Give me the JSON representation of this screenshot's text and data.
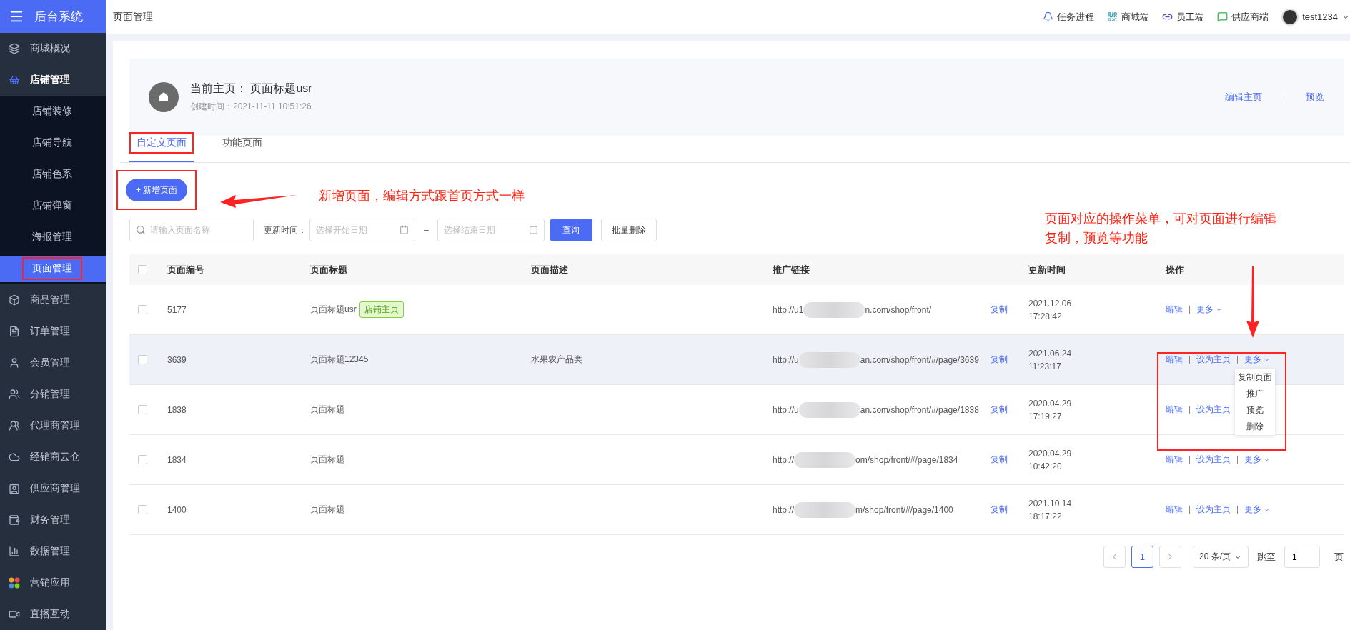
{
  "sidebar": {
    "logo": "后台系统",
    "items": [
      {
        "label": "商城概况",
        "expanded": false
      },
      {
        "label": "店铺管理",
        "expanded": true,
        "children": [
          {
            "label": "店铺装修",
            "selected": false,
            "annotated": false
          },
          {
            "label": "店铺导航",
            "selected": false,
            "annotated": false
          },
          {
            "label": "店铺色系",
            "selected": false,
            "annotated": false
          },
          {
            "label": "店铺弹窗",
            "selected": false,
            "annotated": false
          },
          {
            "label": "海报管理",
            "selected": false,
            "annotated": false
          },
          {
            "label": "页面管理",
            "selected": true,
            "annotated": true
          }
        ]
      },
      {
        "label": "商品管理",
        "expanded": false
      },
      {
        "label": "订单管理",
        "expanded": false
      },
      {
        "label": "会员管理",
        "expanded": false
      },
      {
        "label": "分销管理",
        "expanded": false
      },
      {
        "label": "代理商管理",
        "expanded": false
      },
      {
        "label": "经销商云仓",
        "expanded": false
      },
      {
        "label": "供应商管理",
        "expanded": false
      },
      {
        "label": "财务管理",
        "expanded": false
      },
      {
        "label": "数据管理",
        "expanded": false
      },
      {
        "label": "营销应用",
        "expanded": false
      },
      {
        "label": "直播互动",
        "expanded": false
      }
    ]
  },
  "header": {
    "title": "页面管理",
    "links": [
      {
        "label": "任务进程"
      },
      {
        "label": "商城端"
      },
      {
        "label": "员工端"
      },
      {
        "label": "供应商端"
      }
    ],
    "user": "test1234"
  },
  "home_card": {
    "label": "当前主页：",
    "page": "页面标题usr",
    "created": "创建时间：2021-11-11 10:51:26",
    "actions": [
      "编辑主页",
      "预览"
    ]
  },
  "tabs": [
    {
      "label": "自定义页面",
      "selected": true,
      "annotated": true
    },
    {
      "label": "功能页面",
      "selected": false,
      "annotated": false
    }
  ],
  "new_button": {
    "label": "+ 新增页面",
    "annotated": true
  },
  "filters": {
    "search_placeholder": "请输入页面名称",
    "time_label": "更新时间：",
    "start_placeholder": "选择开始日期",
    "separator": "–",
    "end_placeholder": "选择结束日期",
    "query": "查询",
    "batch_delete": "批量删除"
  },
  "table": {
    "all_checked": false,
    "columns": [
      "页面编号",
      "页面标题",
      "页面描述",
      "推广链接",
      "更新时间",
      "操作"
    ],
    "rows": [
      {
        "checked": false,
        "id": "5177",
        "title": "页面标题usr",
        "tag": "店铺主页",
        "link_start": "http://u1",
        "link_end": "n.com/shop/front/",
        "copy": "复制",
        "date": "2021.12.06",
        "time": "17:28:42",
        "hovered": false,
        "actions": [
          {
            "kind": "link",
            "label": "编辑"
          },
          {
            "kind": "more",
            "label": "更多"
          }
        ]
      },
      {
        "checked": false,
        "id": "3639",
        "title": "页面标题12345",
        "description": "水果农产品类",
        "link_start": "http://u",
        "link_end": "an.com/shop/front/#/page/3639",
        "copy": "复制",
        "date": "2021.06.24",
        "time": "11:23:17",
        "hovered": true,
        "actions": [
          {
            "kind": "link",
            "label": "编辑"
          },
          {
            "kind": "link",
            "label": "设为主页"
          },
          {
            "kind": "more",
            "label": "更多"
          }
        ],
        "menu": [
          "复制页面",
          "推广",
          "预览",
          "删除"
        ]
      },
      {
        "checked": false,
        "id": "1838",
        "title": "页面标题",
        "link_start": "http://u",
        "link_end": "an.com/shop/front/#/page/1838",
        "copy": "复制",
        "date": "2020.04.29",
        "time": "17:19:27",
        "hovered": false,
        "actions": [
          {
            "kind": "link",
            "label": "编辑"
          },
          {
            "kind": "link",
            "label": "设为主页"
          }
        ]
      },
      {
        "checked": false,
        "id": "1834",
        "title": "页面标题",
        "link_start": "http://",
        "link_end": "om/shop/front/#/page/1834",
        "copy": "复制",
        "date": "2020.04.29",
        "time": "10:42:20",
        "hovered": false,
        "actions": [
          {
            "kind": "link",
            "label": "编辑"
          },
          {
            "kind": "link",
            "label": "设为主页"
          },
          {
            "kind": "more",
            "label": "更多"
          }
        ]
      },
      {
        "checked": false,
        "id": "1400",
        "title": "页面标题",
        "link_start": "http://",
        "link_end": "m/shop/front/#/page/1400",
        "copy": "复制",
        "date": "2021.10.14",
        "time": "18:17:22",
        "hovered": false,
        "actions": [
          {
            "kind": "link",
            "label": "编辑"
          },
          {
            "kind": "link",
            "label": "设为主页"
          },
          {
            "kind": "more",
            "label": "更多"
          }
        ]
      }
    ]
  },
  "pagination": {
    "pages": [
      {
        "label": "1",
        "selected": true
      }
    ],
    "page_size": "20 条/页",
    "jump_label": "跳至",
    "jump_value": "1",
    "page_suffix": "页"
  },
  "annotations": [
    {
      "lines": [
        "新增页面，编辑方式跟首页方式一样"
      ]
    },
    {
      "lines": [
        "页面对应的操作菜单，可对页面进行编辑",
        "复制，预览等功能"
      ]
    }
  ]
}
